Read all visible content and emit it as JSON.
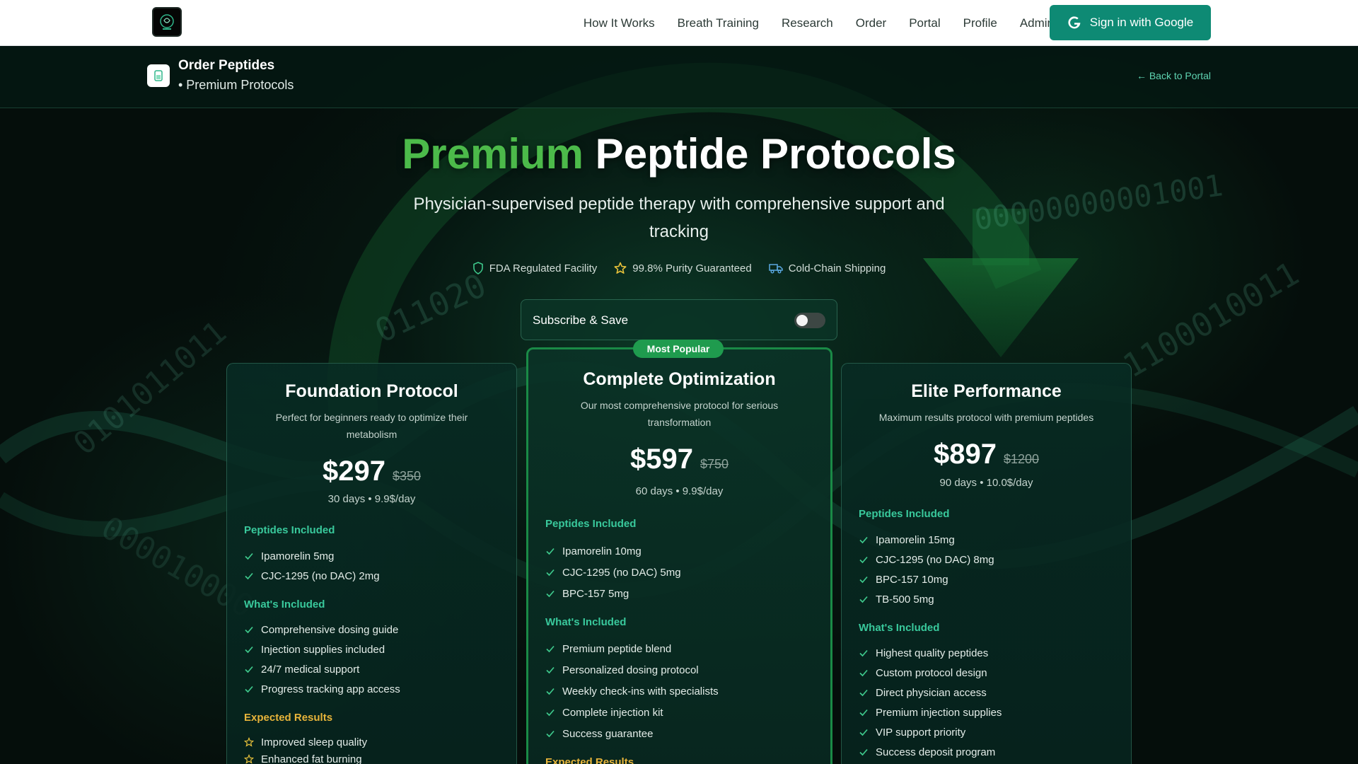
{
  "nav": {
    "links": [
      "How It Works",
      "Breath Training",
      "Research",
      "Order",
      "Portal",
      "Profile",
      "Admin"
    ],
    "sign_in_label": "Sign in with Google"
  },
  "subheader": {
    "title": "Order Peptides",
    "subtitle": "• Premium Protocols",
    "back_label": "← Back to Portal"
  },
  "hero": {
    "title_accent": "Premium",
    "title_rest": " Peptide Protocols",
    "subtitle": "Physician-supervised peptide therapy with comprehensive support and tracking",
    "badges": [
      "FDA Regulated Facility",
      "99.8% Purity Guaranteed",
      "Cold-Chain Shipping"
    ],
    "subscribe_label": "Subscribe & Save",
    "subscribe_enabled": false
  },
  "colors": {
    "accent_green": "#4cba4a",
    "teal": "#39c99c",
    "gold": "#e7b43a",
    "button": "#0e8a74",
    "popular": "#1f9b4e"
  },
  "plans": [
    {
      "name": "Foundation Protocol",
      "description": "Perfect for beginners ready to optimize their metabolism",
      "price": "$297",
      "original_price": "$350",
      "per": "30 days • 9.9$/day",
      "peptides_heading": "Peptides Included",
      "peptides": [
        "Ipamorelin 5mg",
        "CJC-1295 (no DAC) 2mg"
      ],
      "included_heading": "What's Included",
      "included": [
        "Comprehensive dosing guide",
        "Injection supplies included",
        "24/7 medical support",
        "Progress tracking app access"
      ],
      "results_heading": "Expected Results",
      "results": [
        "Improved sleep quality",
        "Enhanced fat burning"
      ]
    },
    {
      "name": "Complete Optimization",
      "badge": "Most Popular",
      "description": "Our most comprehensive protocol for serious transformation",
      "price": "$597",
      "original_price": "$750",
      "per": "60 days • 9.9$/day",
      "peptides_heading": "Peptides Included",
      "peptides": [
        "Ipamorelin 10mg",
        "CJC-1295 (no DAC) 5mg",
        "BPC-157 5mg"
      ],
      "included_heading": "What's Included",
      "included": [
        "Premium peptide blend",
        "Personalized dosing protocol",
        "Weekly check-ins with specialists",
        "Complete injection kit",
        "Success guarantee"
      ],
      "results_heading": "Expected Results"
    },
    {
      "name": "Elite Performance",
      "description": "Maximum results protocol with premium peptides",
      "price": "$897",
      "original_price": "$1200",
      "per": "90 days • 10.0$/day",
      "peptides_heading": "Peptides Included",
      "peptides": [
        "Ipamorelin 15mg",
        "CJC-1295 (no DAC) 8mg",
        "BPC-157 10mg",
        "TB-500 5mg"
      ],
      "included_heading": "What's Included",
      "included": [
        "Highest quality peptides",
        "Custom protocol design",
        "Direct physician access",
        "Premium injection supplies",
        "VIP support priority",
        "Success deposit program"
      ]
    }
  ]
}
